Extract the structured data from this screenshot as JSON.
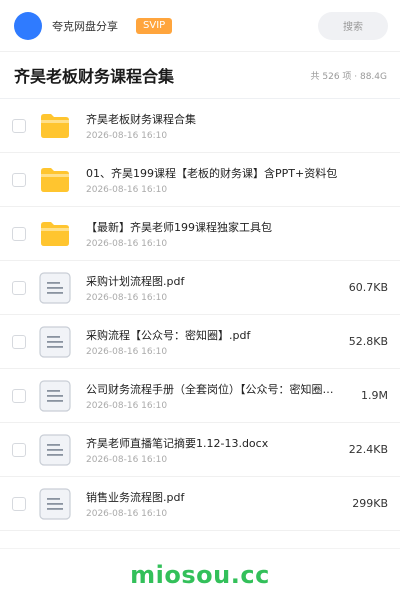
{
  "topbar": {
    "user_name": "夸克网盘分享",
    "vip_badge": "SVIP",
    "search_placeholder": "搜索"
  },
  "header": {
    "title": "齐昊老板财务课程合集",
    "summary": "共 526 项 · 88.4G"
  },
  "files": [
    {
      "type": "folder-icon",
      "name": "齐昊老板财务课程合集",
      "date": "2026-08-16 16:10",
      "size": ""
    },
    {
      "type": "folder-icon",
      "name": "01、齐昊199课程【老板的财务课】含PPT+资料包",
      "date": "2026-08-16 16:10",
      "size": ""
    },
    {
      "type": "folder-icon",
      "name": "【最新】齐昊老师199课程独家工具包",
      "date": "2026-08-16 16:10",
      "size": ""
    },
    {
      "type": "document-icon",
      "name": "采购计划流程图.pdf",
      "date": "2026-08-16 16:10",
      "size": "60.7KB"
    },
    {
      "type": "document-icon",
      "name": "采购流程【公众号：密知圈】.pdf",
      "date": "2026-08-16 16:10",
      "size": "52.8KB"
    },
    {
      "type": "document-icon",
      "name": "公司财务流程手册（全套岗位）【公众号：密知圈】.p…",
      "date": "2026-08-16 16:10",
      "size": "1.9M"
    },
    {
      "type": "document-icon",
      "name": "齐昊老师直播笔记摘要1.12-13.docx",
      "date": "2026-08-16 16:10",
      "size": "22.4KB"
    },
    {
      "type": "document-icon",
      "name": "销售业务流程图.pdf",
      "date": "2026-08-16 16:10",
      "size": "299KB"
    }
  ],
  "footer": {
    "watermark": "miosou.cc"
  },
  "colors": {
    "accent_blue": "#2f7bff",
    "vip_orange": "#ffa53d",
    "folder_yellow": "#ffc52f",
    "watermark_green": "#33c05a"
  }
}
